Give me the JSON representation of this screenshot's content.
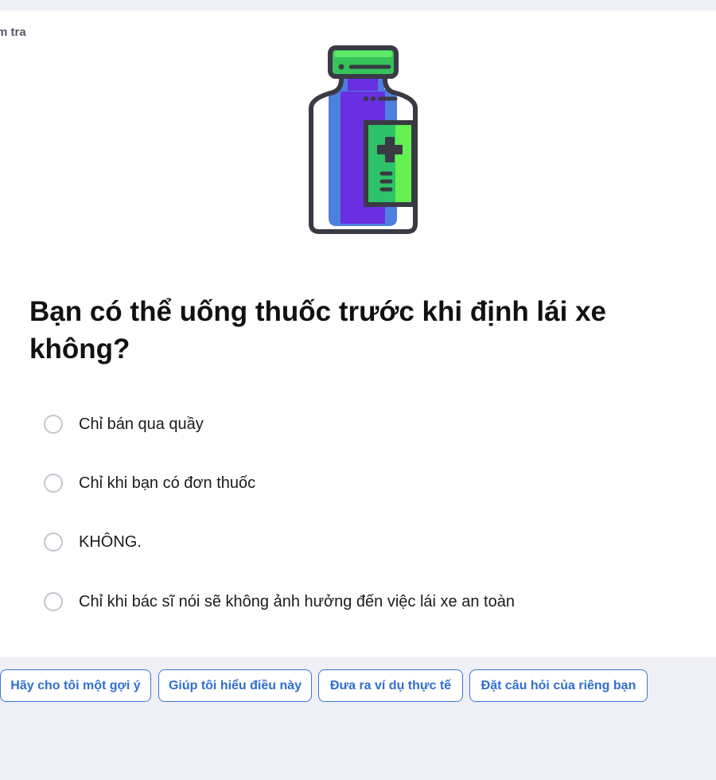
{
  "header": {
    "corner_label": "m tra"
  },
  "illustration": {
    "icon": "medicine-bottle-icon",
    "colors": {
      "cap": "#34c45b",
      "body_purple": "#6a2fe0",
      "body_blue": "#4d7fde",
      "label_green": "#2ec26a",
      "label_light": "#64f053",
      "outline": "#3a3a44"
    }
  },
  "question": {
    "text": "Bạn có thể uống thuốc trước khi định lái xe không?"
  },
  "options": [
    {
      "label": "Chỉ bán qua quầy",
      "selected": false
    },
    {
      "label": "Chỉ khi bạn có đơn thuốc",
      "selected": false
    },
    {
      "label": "KHÔNG.",
      "selected": false
    },
    {
      "label": "Chỉ khi bác sĩ nói sẽ không ảnh hưởng đến việc lái xe an toàn",
      "selected": false
    }
  ],
  "helpers": [
    {
      "label": "Hãy cho tôi một gợi ý"
    },
    {
      "label": "Giúp tôi hiểu điều này"
    },
    {
      "label": "Đưa ra ví dụ thực tế"
    },
    {
      "label": "Đặt câu hỏi của riêng bạn"
    }
  ],
  "colors": {
    "page_bg": "#eff0f5",
    "card_bg": "#ffffff",
    "accent": "#2f6fcf",
    "radio_border": "#c4c6d0"
  }
}
